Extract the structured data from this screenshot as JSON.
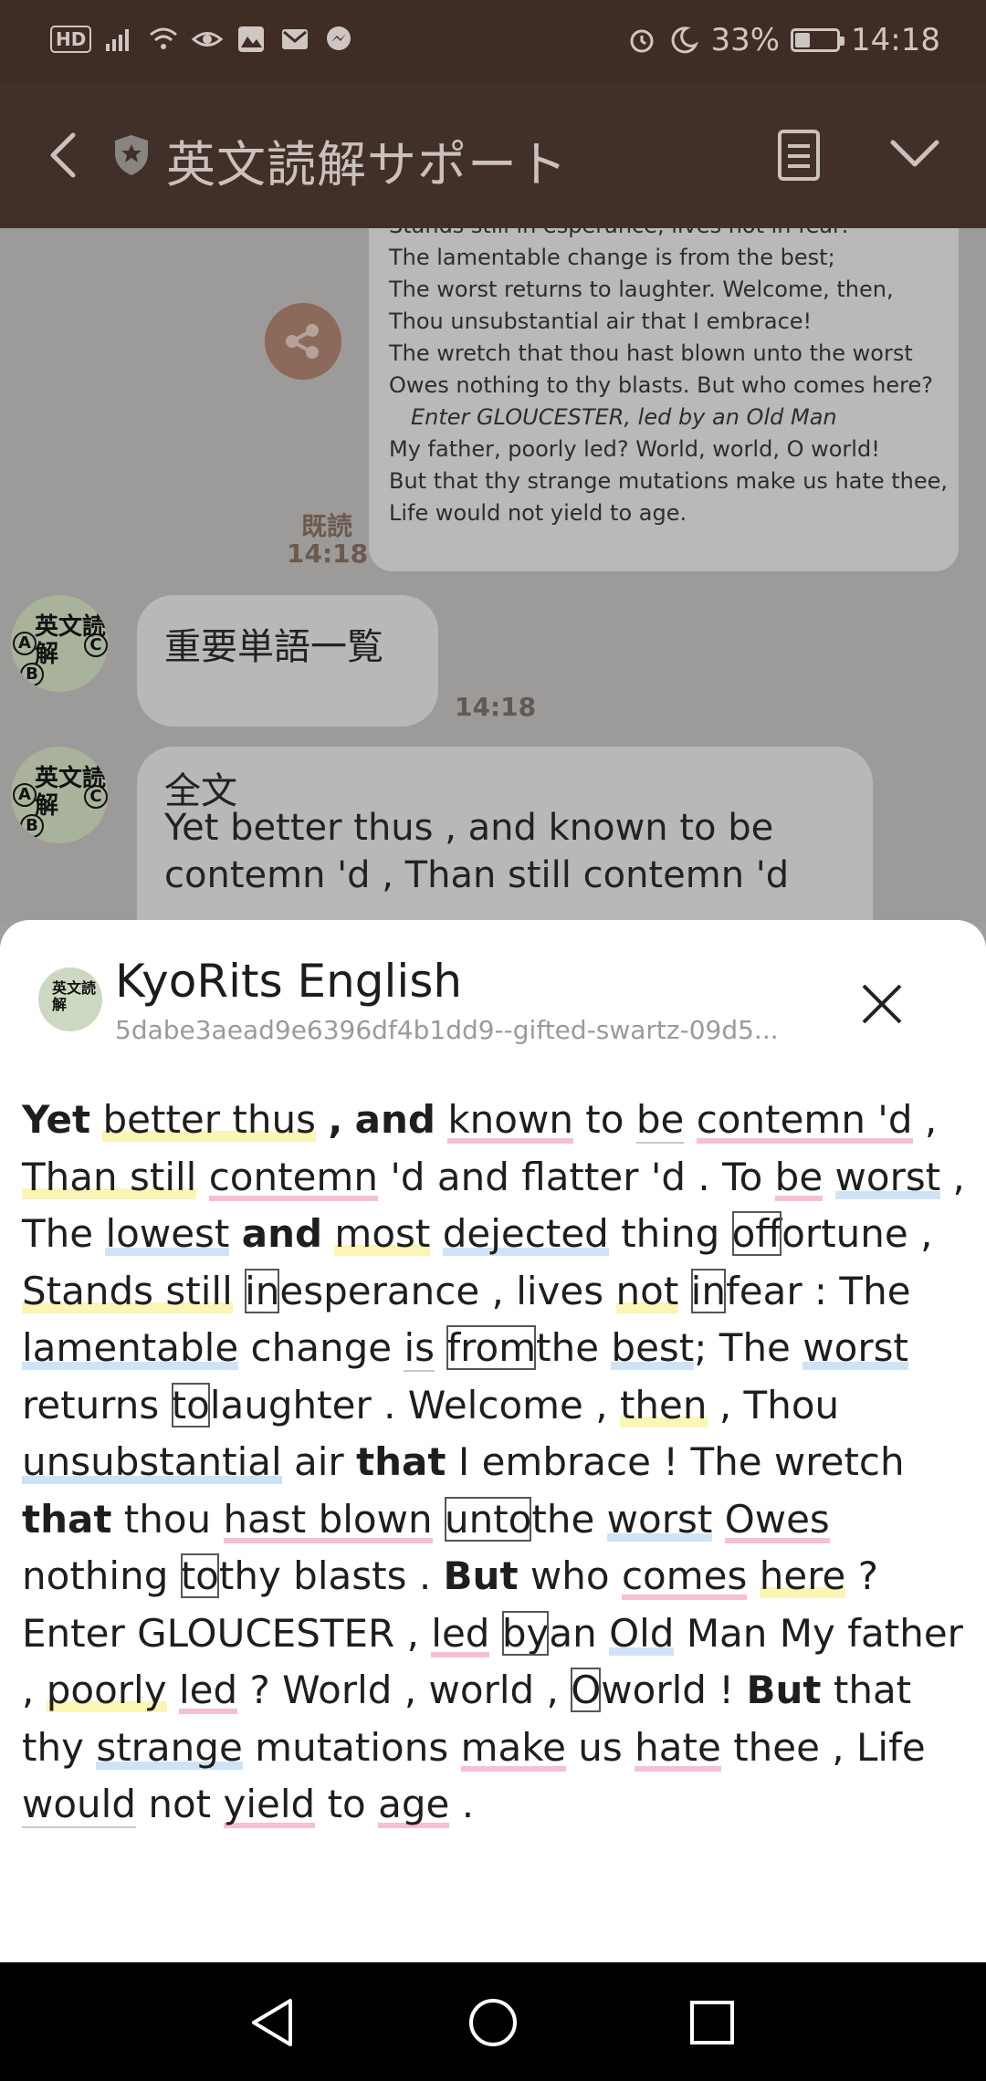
{
  "status_bar": {
    "left_icons": [
      "hd-icon",
      "signal-icon",
      "wifi-icon",
      "eye-icon",
      "gallery-icon",
      "mail-icon",
      "messenger-icon"
    ],
    "hd_label": "HD",
    "battery_percent_text": "33%",
    "battery_level": 0.33,
    "time": "14:18"
  },
  "header": {
    "title": "英文読解サポート"
  },
  "chat": {
    "outgoing_message_lines": [
      "Stands still in esperance, lives not in fear:",
      "The lamentable change is from the best;",
      "The worst returns to laughter. Welcome, then,",
      "Thou unsubstantial air that I embrace!",
      "The wretch that thou hast blown unto the worst",
      "Owes nothing to thy blasts. But who comes here?",
      "Enter GLOUCESTER, led by an Old Man",
      "My father, poorly led? World, world, O world!",
      "But that thy strange mutations make us hate thee,",
      "Life would not yield to age."
    ],
    "read_label": "既読",
    "read_time": "14:18",
    "avatar_text": "英文読解",
    "avatar_badges": [
      "A",
      "B",
      "C"
    ],
    "bubble1_text": "重要単語一覧",
    "bubble1_time": "14:18",
    "bubble2_title": "全文",
    "bubble2_lines": [
      "Yet better thus , and known to be",
      "contemn 'd , Than still contemn 'd"
    ]
  },
  "sheet": {
    "avatar_text": "英文読解",
    "title": "KyoRits English",
    "subtitle": "5dabe3aead9e6396df4b1dd9--gifted-swartz-09d5...",
    "tokens": [
      {
        "t": "Yet",
        "s": "b"
      },
      {
        "t": "better thus",
        "s": "hl-yellow"
      },
      {
        "t": ",",
        "s": "b"
      },
      {
        "t": "and",
        "s": "b"
      },
      {
        "t": "known",
        "s": "hl-pink"
      },
      {
        "t": "to",
        "s": ""
      },
      {
        "t": "be",
        "s": "hl-gray"
      },
      {
        "t": "contemn 'd",
        "s": "hl-pink"
      },
      {
        "t": ",",
        "s": ""
      },
      {
        "t": "Than still",
        "s": "hl-yellow"
      },
      {
        "t": "contemn",
        "s": "hl-pink"
      },
      {
        "t": "'d and flatter 'd . To",
        "s": ""
      },
      {
        "t": "be",
        "s": "hl-pink"
      },
      {
        "t": "worst",
        "s": "hl-blue"
      },
      {
        "t": ",",
        "s": ""
      },
      {
        "t": "The",
        "s": ""
      },
      {
        "t": "lowest",
        "s": "hl-blue"
      },
      {
        "t": "and",
        "s": "b"
      },
      {
        "t": "most",
        "s": "hl-yellow"
      },
      {
        "t": "dejected",
        "s": "hl-blue"
      },
      {
        "t": "thing",
        "s": ""
      },
      {
        "t": "of",
        "s": "boxed"
      },
      {
        "t": "fortune ,",
        "s": "nsp"
      },
      {
        "t": "Stands still",
        "s": "hl-yellow"
      },
      {
        "t": "in",
        "s": "boxed"
      },
      {
        "t": "esperance , lives",
        "s": "nsp"
      },
      {
        "t": "not",
        "s": "hl-yellow"
      },
      {
        "t": "in",
        "s": "boxed"
      },
      {
        "t": "fear : The",
        "s": "nsp"
      },
      {
        "t": "lamentable",
        "s": "hl-blue"
      },
      {
        "t": "change",
        "s": ""
      },
      {
        "t": "is",
        "s": "hl-gray"
      },
      {
        "t": "from",
        "s": "boxed"
      },
      {
        "t": "the",
        "s": "nsp"
      },
      {
        "t": "best",
        "s": "hl-blue"
      },
      {
        "t": "; The",
        "s": "nsp"
      },
      {
        "t": "worst",
        "s": "hl-blue"
      },
      {
        "t": "returns",
        "s": ""
      },
      {
        "t": "to",
        "s": "boxed"
      },
      {
        "t": "laughter . Welcome ,",
        "s": "nsp"
      },
      {
        "t": "then",
        "s": "hl-yellow"
      },
      {
        "t": ", Thou",
        "s": ""
      },
      {
        "t": "unsubstantial",
        "s": "hl-blue"
      },
      {
        "t": "air",
        "s": ""
      },
      {
        "t": "that",
        "s": "b"
      },
      {
        "t": "I embrace ! The wretch",
        "s": ""
      },
      {
        "t": "that",
        "s": "b"
      },
      {
        "t": "thou",
        "s": ""
      },
      {
        "t": "hast blown",
        "s": "hl-pink"
      },
      {
        "t": "unto",
        "s": "boxed"
      },
      {
        "t": "the",
        "s": "nsp"
      },
      {
        "t": "worst",
        "s": "hl-blue"
      },
      {
        "t": "Owes",
        "s": "hl-pink"
      },
      {
        "t": "nothing",
        "s": ""
      },
      {
        "t": "to",
        "s": "boxed"
      },
      {
        "t": "thy blasts .",
        "s": "nsp"
      },
      {
        "t": "But",
        "s": "b"
      },
      {
        "t": "who",
        "s": ""
      },
      {
        "t": "comes",
        "s": "hl-pink"
      },
      {
        "t": "here",
        "s": "hl-yellow"
      },
      {
        "t": "?",
        "s": ""
      },
      {
        "t": "Enter GLOUCESTER ,",
        "s": ""
      },
      {
        "t": "led",
        "s": "hl-pink"
      },
      {
        "t": "by",
        "s": "boxed"
      },
      {
        "t": "an",
        "s": "nsp"
      },
      {
        "t": "Old",
        "s": "hl-blue"
      },
      {
        "t": "Man My",
        "s": ""
      },
      {
        "t": "father ,",
        "s": ""
      },
      {
        "t": "poorly",
        "s": "hl-yellow"
      },
      {
        "t": "led",
        "s": "hl-pink"
      },
      {
        "t": "? World , world ,",
        "s": ""
      },
      {
        "t": "O",
        "s": "boxed"
      },
      {
        "t": "world !",
        "s": "nsp"
      },
      {
        "t": "But",
        "s": "b"
      },
      {
        "t": "that thy",
        "s": ""
      },
      {
        "t": "strange",
        "s": "hl-blue"
      },
      {
        "t": "mutations",
        "s": ""
      },
      {
        "t": "make",
        "s": "hl-pink"
      },
      {
        "t": "us",
        "s": ""
      },
      {
        "t": "hate",
        "s": "hl-pink"
      },
      {
        "t": "thee ,",
        "s": ""
      },
      {
        "t": "Life",
        "s": ""
      },
      {
        "t": "would",
        "s": "hl-gray"
      },
      {
        "t": "not",
        "s": ""
      },
      {
        "t": "yield",
        "s": "hl-pink"
      },
      {
        "t": "to",
        "s": ""
      },
      {
        "t": "age",
        "s": "hl-pink"
      },
      {
        "t": ".",
        "s": ""
      }
    ]
  },
  "colors": {
    "status_bar_bg": "#3f2c24",
    "header_bg": "#41302a",
    "highlight_pink": "#f6bed7",
    "highlight_blue": "#cfe3f8",
    "highlight_yellow": "#fbf5b6"
  },
  "navbar": {
    "buttons": [
      "back-triangle-icon",
      "home-circle-icon",
      "recents-square-icon"
    ]
  }
}
